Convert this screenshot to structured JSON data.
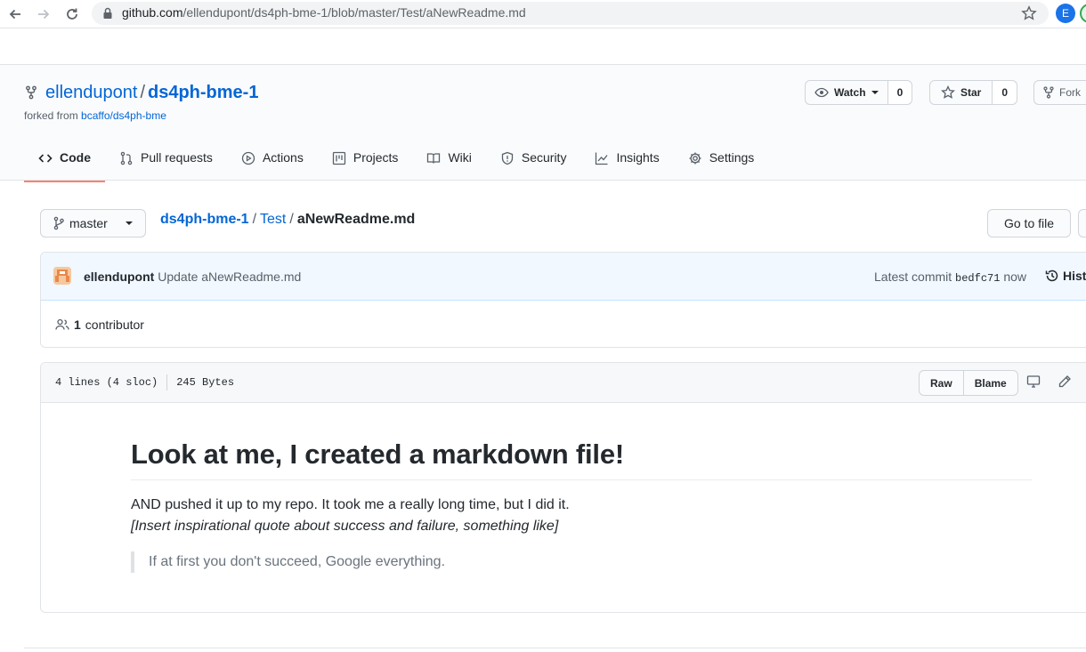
{
  "browser": {
    "url_host": "github.com",
    "url_path": "/ellendupont/ds4ph-bme-1/blob/master/Test/aNewReadme.md",
    "profile_initial": "E",
    "icons": [
      "back-arrow-icon",
      "forward-arrow-icon",
      "reload-icon",
      "lock-icon",
      "bookmark-star-icon"
    ]
  },
  "repo": {
    "owner": "ellendupont",
    "separator": "/",
    "name": "ds4ph-bme-1",
    "forked_from_label": "forked from",
    "forked_from_repo": "bcaffo/ds4ph-bme",
    "watch_label": "Watch",
    "watch_count": "0",
    "star_label": "Star",
    "star_count": "0",
    "fork_label": "Fork"
  },
  "tabs": [
    {
      "label": "Code",
      "icon": "code-icon",
      "selected": true
    },
    {
      "label": "Pull requests",
      "icon": "pull-request-icon"
    },
    {
      "label": "Actions",
      "icon": "play-icon"
    },
    {
      "label": "Projects",
      "icon": "project-icon"
    },
    {
      "label": "Wiki",
      "icon": "book-icon"
    },
    {
      "label": "Security",
      "icon": "shield-icon"
    },
    {
      "label": "Insights",
      "icon": "graph-icon"
    },
    {
      "label": "Settings",
      "icon": "gear-icon"
    }
  ],
  "filenav": {
    "branch": "master",
    "crumb_repo": "ds4ph-bme-1",
    "crumb_sep": "/",
    "crumb_dir": "Test",
    "crumb_file": "aNewReadme.md",
    "goto_file": "Go to file"
  },
  "commit": {
    "author": "ellendupont",
    "message": "Update aNewReadme.md",
    "latest_label": "Latest commit",
    "sha": "bedfc71",
    "time": "now",
    "history_label": "Hist",
    "contributor_count": "1",
    "contributor_label": "contributor"
  },
  "file": {
    "lines": "4 lines (4 sloc)",
    "size": "245 Bytes",
    "raw": "Raw",
    "blame": "Blame"
  },
  "markdown": {
    "heading": "Look at me, I created a markdown file!",
    "line1": "AND pushed it up to my repo. It took me a really long time, but I did it.",
    "line2": "[Insert inspirational quote about success and failure, something like]",
    "quote": "If at first you don't succeed, Google everything."
  },
  "colors": {
    "link": "#0366d6",
    "tab_underline": "#f9826c",
    "commit_bg": "#f1f8ff"
  }
}
